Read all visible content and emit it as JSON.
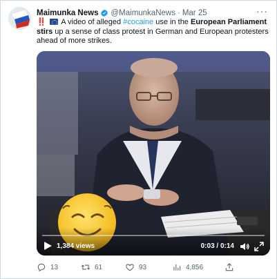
{
  "author": {
    "name": "Maimunka News",
    "handle": "@MaimunkaNews",
    "separator": "·",
    "date": "Mar 25"
  },
  "more_icon": "more-icon",
  "tweet": {
    "bang": "‼️",
    "part1": " A video of alleged ",
    "hashtag": "#cocaine",
    "part2": " use in the ",
    "bold": "European Parliament stirs",
    "part3": " up a sense of class protest in German and European protesters ahead of more strikes."
  },
  "video": {
    "views": "1,384 views",
    "time": "0:03 / 0:14",
    "progress": 0.0,
    "accent": "#1d9bf0"
  },
  "actions": {
    "replies": "13",
    "retweets": "61",
    "likes": "93",
    "views": "4,856"
  },
  "colors": {
    "text": "#0f1419",
    "secondary": "#536471",
    "link": "#1d9bf0",
    "border": "#cfd9de"
  }
}
